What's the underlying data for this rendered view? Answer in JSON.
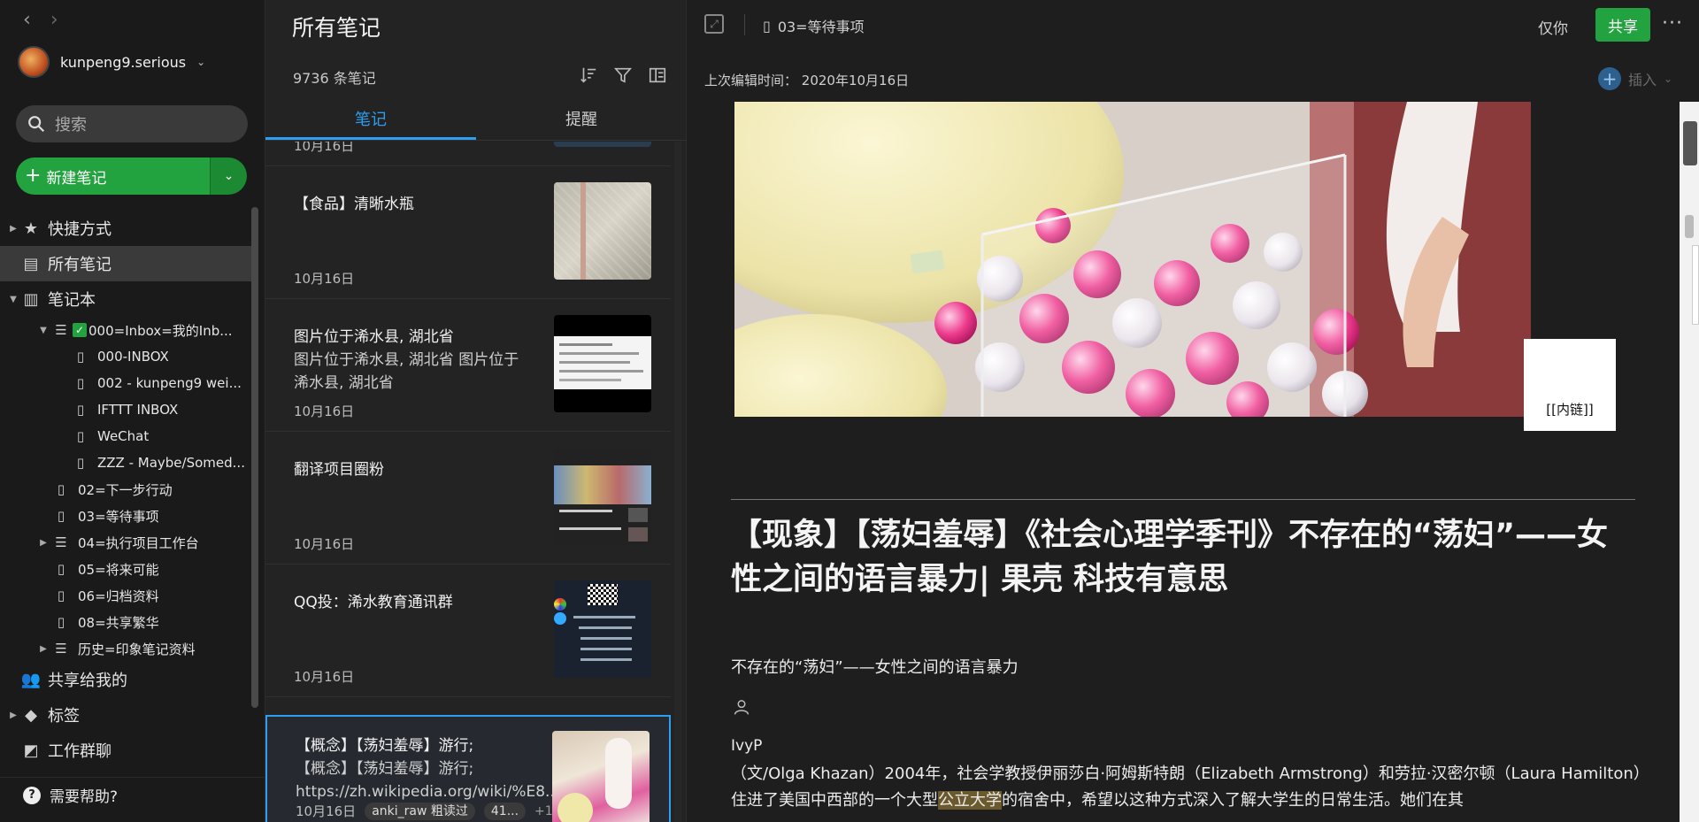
{
  "sidebar": {
    "user_name": "kunpeng9.serious",
    "search_placeholder": "搜索",
    "new_note_label": "新建笔记",
    "items": [
      {
        "label": "快捷方式"
      },
      {
        "label": "所有笔记"
      },
      {
        "label": "笔记本"
      },
      {
        "label": "000=Inbox=我的Inb..."
      },
      {
        "label": "000-INBOX"
      },
      {
        "label": "002 - kunpeng9 wei..."
      },
      {
        "label": "IFTTT INBOX"
      },
      {
        "label": "WeChat"
      },
      {
        "label": "ZZZ - Maybe/Somed..."
      },
      {
        "label": "02=下一步行动"
      },
      {
        "label": "03=等待事项"
      },
      {
        "label": "04=执行项目工作台"
      },
      {
        "label": "05=将来可能"
      },
      {
        "label": "06=归档资料"
      },
      {
        "label": "08=共享繁华"
      },
      {
        "label": "历史=印象笔记资料"
      },
      {
        "label": "共享给我的"
      },
      {
        "label": "标签"
      },
      {
        "label": "工作群聊"
      }
    ],
    "help_label": "需要帮助?"
  },
  "note_list": {
    "title": "所有笔记",
    "count": "9736 条笔记",
    "tabs": [
      "笔记",
      "提醒"
    ],
    "cards": [
      {
        "title": "",
        "snippet": "",
        "date": "10月16日"
      },
      {
        "title": "【食品】清晰水瓶",
        "snippet": "",
        "date": "10月16日"
      },
      {
        "title": "图片位于浠水县, 湖北省",
        "snippet": "图片位于浠水县, 湖北省 图片位于浠水县, 湖北省",
        "date": "10月16日"
      },
      {
        "title": "翻译项目圈粉",
        "snippet": "",
        "date": "10月16日"
      },
      {
        "title": "QQ投：浠水教育通讯群",
        "snippet": "",
        "date": "10月16日"
      },
      {
        "title": "【概念】【荡妇羞辱】游行;",
        "snippet": "【概念】【荡妇羞辱】游行; https://zh.wikipedia.org/wiki/%E8...",
        "date": "10月16日",
        "tag": "anki_raw 粗读过",
        "tag2": "41...",
        "more": "+1"
      }
    ]
  },
  "editor": {
    "breadcrumb": "03=等待事项",
    "visibility": "仅你",
    "share_label": "共享",
    "more_label": "···",
    "last_edited_label": "上次编辑时间：",
    "last_edited_value": "2020年10月16日",
    "insert_label": "插入",
    "inner_link_label": "[[内链]]",
    "article_title": "【现象】【荡妇羞辱】《社会心理学季刊》不存在的“荡妇”——女性之间的语言暴力| 果壳 科技有意思",
    "subtitle": "不存在的“荡妇”——女性之间的语言暴力",
    "author": "IvyP",
    "body_part1": "（文/Olga Khazan）2004年，社会学教授伊丽莎白·阿姆斯特朗（Elizabeth Armstrong）和劳拉·汉密尔顿（Laura Hamilton）住进了美国中西部的一个大型",
    "body_highlight": "公立大学",
    "body_part2": "的宿舍中，希望以这种方式深入了解大学生的日常生活。她们在其"
  },
  "colors": {
    "accent_green": "#23a33f",
    "accent_blue": "#2d9ff0",
    "background": "#1e1e1e"
  }
}
